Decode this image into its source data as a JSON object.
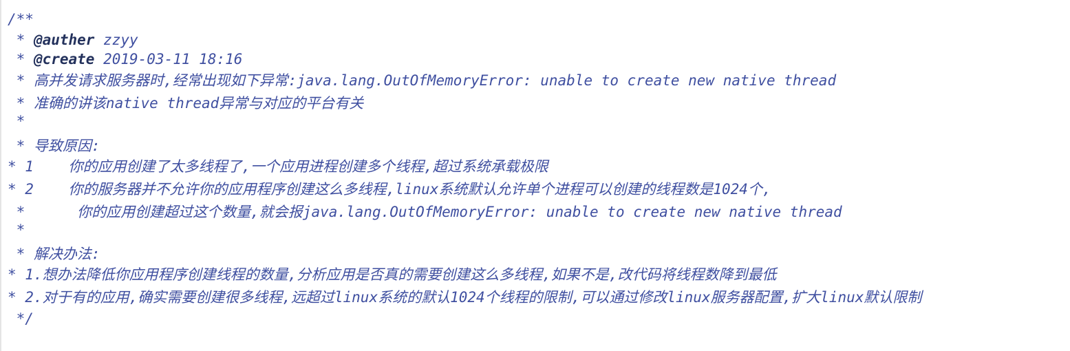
{
  "editor": {
    "lines": [
      {
        "prefix": "/**",
        "tag": "",
        "text": ""
      },
      {
        "prefix": " * ",
        "tag": "@auther",
        "text": " zzyy"
      },
      {
        "prefix": " * ",
        "tag": "@create",
        "text": " 2019-03-11 18:16"
      },
      {
        "prefix": " * ",
        "tag": "",
        "text": "高并发请求服务器时,经常出现如下异常:java.lang.OutOfMemoryError: unable to create new native thread"
      },
      {
        "prefix": " * ",
        "tag": "",
        "text": "准确的讲该native thread异常与对应的平台有关"
      },
      {
        "prefix": " *",
        "tag": "",
        "text": ""
      },
      {
        "prefix": " * ",
        "tag": "",
        "text": "导致原因:"
      },
      {
        "prefix": "* 1    ",
        "tag": "",
        "text": "你的应用创建了太多线程了,一个应用进程创建多个线程,超过系统承载极限"
      },
      {
        "prefix": "* 2    ",
        "tag": "",
        "text": "你的服务器并不允许你的应用程序创建这么多线程,linux系统默认允许单个进程可以创建的线程数是1024个,"
      },
      {
        "prefix": " *      ",
        "tag": "",
        "text": "你的应用创建超过这个数量,就会报java.lang.OutOfMemoryError: unable to create new native thread"
      },
      {
        "prefix": " *",
        "tag": "",
        "text": ""
      },
      {
        "prefix": " * ",
        "tag": "",
        "text": "解决办法:"
      },
      {
        "prefix": "* ",
        "tag": "",
        "text": "1.想办法降低你应用程序创建线程的数量,分析应用是否真的需要创建这么多线程,如果不是,改代码将线程数降到最低"
      },
      {
        "prefix": "* ",
        "tag": "",
        "text": "2.对于有的应用,确实需要创建很多线程,远超过linux系统的默认1024个线程的限制,可以通过修改linux服务器配置,扩大linux默认限制"
      },
      {
        "prefix": " */",
        "tag": "",
        "text": ""
      }
    ]
  }
}
